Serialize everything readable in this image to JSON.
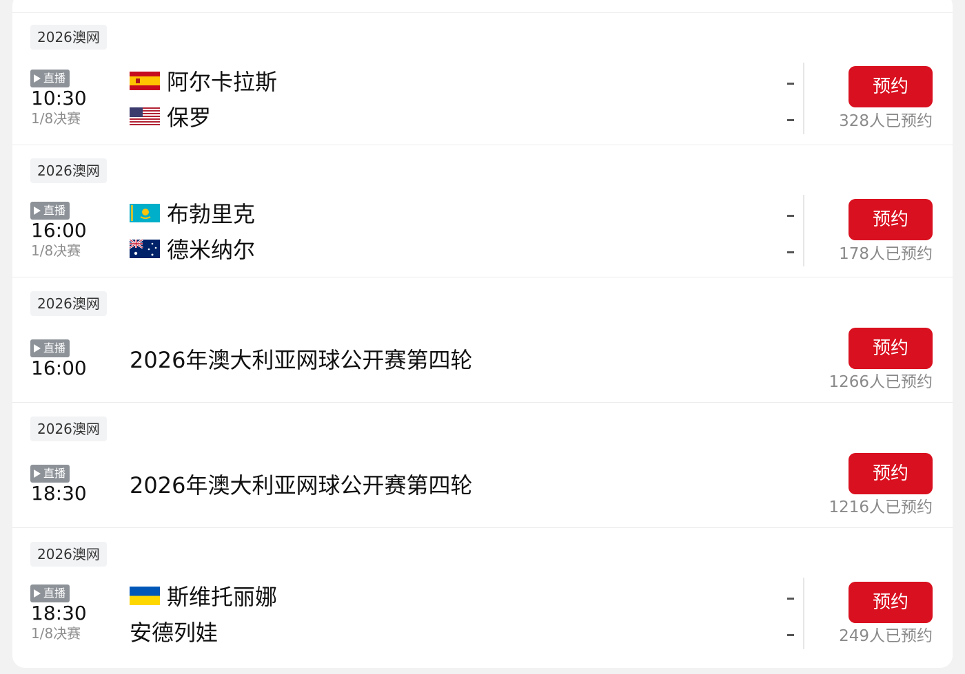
{
  "matches": [
    {
      "tag": "2026澳网",
      "live": "直播",
      "time": "10:30",
      "round": "1/8决赛",
      "team1": "阿尔卡拉斯",
      "team2": "保罗",
      "flag1": "spain-flag-icon",
      "flag2": "usa-flag-icon",
      "score1": "-",
      "score2": "-",
      "button": "预约",
      "count": "328人已预约"
    },
    {
      "tag": "2026澳网",
      "live": "直播",
      "time": "16:00",
      "round": "1/8决赛",
      "team1": "布勃里克",
      "team2": "德米纳尔",
      "flag1": "kazakhstan-flag-icon",
      "flag2": "australia-flag-icon",
      "score1": "-",
      "score2": "-",
      "button": "预约",
      "count": "178人已预约"
    },
    {
      "tag": "2026澳网",
      "live": "直播",
      "time": "16:00",
      "event": "2026年澳大利亚网球公开赛第四轮",
      "button": "预约",
      "count": "1266人已预约"
    },
    {
      "tag": "2026澳网",
      "live": "直播",
      "time": "18:30",
      "event": "2026年澳大利亚网球公开赛第四轮",
      "button": "预约",
      "count": "1216人已预约"
    },
    {
      "tag": "2026澳网",
      "live": "直播",
      "time": "18:30",
      "round": "1/8决赛",
      "team1": "斯维托丽娜",
      "team2": "安德列娃",
      "flag1": "ukraine-flag-icon",
      "score1": "-",
      "score2": "-",
      "button": "预约",
      "count": "249人已预约"
    }
  ],
  "colors": {
    "accent": "#d9101f",
    "live_badge": "#8d9298",
    "muted_text": "#8a8a8a"
  }
}
